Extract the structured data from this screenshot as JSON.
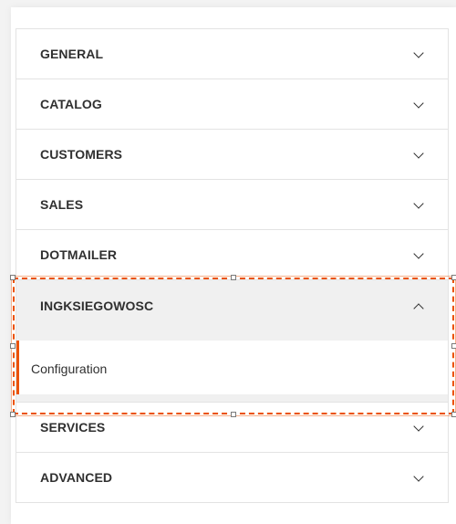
{
  "colors": {
    "accent": "#eb5202",
    "text": "#303030",
    "border": "#e3e3e3",
    "expanded_bg": "#f0f0f0"
  },
  "sections": [
    {
      "label": "GENERAL",
      "icon": "chevron-down-icon"
    },
    {
      "label": "CATALOG",
      "icon": "chevron-down-icon"
    },
    {
      "label": "CUSTOMERS",
      "icon": "chevron-down-icon"
    },
    {
      "label": "SALES",
      "icon": "chevron-down-icon"
    },
    {
      "label": "DOTMAILER",
      "icon": "chevron-down-icon"
    },
    {
      "label": "INGKSIEGOWOSC",
      "icon": "chevron-up-icon",
      "expanded": true,
      "items": [
        {
          "label": "Configuration",
          "active": true
        }
      ]
    },
    {
      "label": "SERVICES",
      "icon": "chevron-down-icon"
    },
    {
      "label": "ADVANCED",
      "icon": "chevron-down-icon"
    }
  ]
}
